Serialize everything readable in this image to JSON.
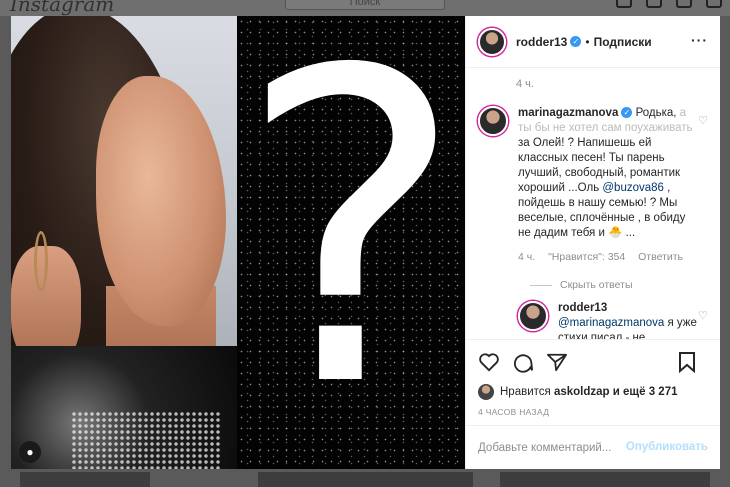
{
  "app": {
    "logo": "Instagram",
    "search_placeholder": "Поиск"
  },
  "post": {
    "author": "rodder13",
    "follow_state": "Подписки",
    "caption_time": "4 ч."
  },
  "comments": [
    {
      "user": "marinagazmanova",
      "text_parts": [
        "Родька, ",
        "а ты бы не хотел сам поухаживать",
        " за Олей! ? Напишешь ей классных песен! Ты парень лучший, свободный, романтик хороший ...Оль ",
        "@buzova86",
        " , пойдешь в нашу семью! ? Мы веселые, сплочённые , в обиду не дадим тебя и 🐣 ..."
      ],
      "time": "4 ч.",
      "likes": "\"Нравится\": 354",
      "reply_label": "Ответить"
    }
  ],
  "hide_replies": "Скрыть ответы",
  "reply": {
    "user": "rodder13",
    "mention": "@marinagazmanova",
    "text": " я уже стихи писал - не реагирует )"
  },
  "likes": {
    "prefix": "Нравится ",
    "user": "askoldzap",
    "suffix": " и ещё 3 271"
  },
  "ago": "4 ЧАСОВ НАЗАД",
  "add_comment": {
    "placeholder": "Добавьте комментарий...",
    "publish": "Опубликовать"
  },
  "colors": {
    "accent": "#3897f0",
    "publish_disabled": "#b2dffc"
  }
}
